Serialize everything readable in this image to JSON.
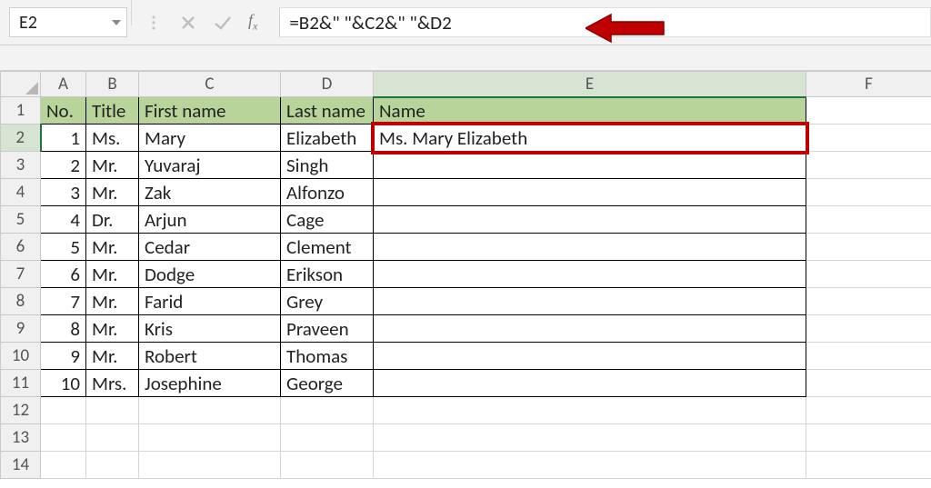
{
  "namebox": {
    "value": "E2"
  },
  "formula": {
    "text": "=B2&\" \"&C2&\" \"&D2"
  },
  "columns": [
    "A",
    "B",
    "C",
    "D",
    "E",
    "F"
  ],
  "headers": {
    "A": "No.",
    "B": "Title",
    "C": "First name",
    "D": "Last name",
    "E": "Name"
  },
  "rows": [
    {
      "no": "1",
      "title": "Ms.",
      "first": "Mary",
      "last": "Elizabeth",
      "name": "Ms. Mary Elizabeth"
    },
    {
      "no": "2",
      "title": "Mr.",
      "first": "Yuvaraj",
      "last": "Singh",
      "name": ""
    },
    {
      "no": "3",
      "title": "Mr.",
      "first": "Zak",
      "last": "Alfonzo",
      "name": ""
    },
    {
      "no": "4",
      "title": "Dr.",
      "first": "Arjun",
      "last": "Cage",
      "name": ""
    },
    {
      "no": "5",
      "title": "Mr.",
      "first": "Cedar",
      "last": "Clement",
      "name": ""
    },
    {
      "no": "6",
      "title": "Mr.",
      "first": "Dodge",
      "last": "Erikson",
      "name": ""
    },
    {
      "no": "7",
      "title": "Mr.",
      "first": "Farid",
      "last": "Grey",
      "name": ""
    },
    {
      "no": "8",
      "title": "Mr.",
      "first": "Kris",
      "last": "Praveen",
      "name": ""
    },
    {
      "no": "9",
      "title": "Mr.",
      "first": "Robert",
      "last": "Thomas",
      "name": ""
    },
    {
      "no": "10",
      "title": "Mrs.",
      "first": "Josephine",
      "last": "George",
      "name": ""
    }
  ],
  "active_cell": "E2",
  "selected_col": "E",
  "selected_row": 2
}
